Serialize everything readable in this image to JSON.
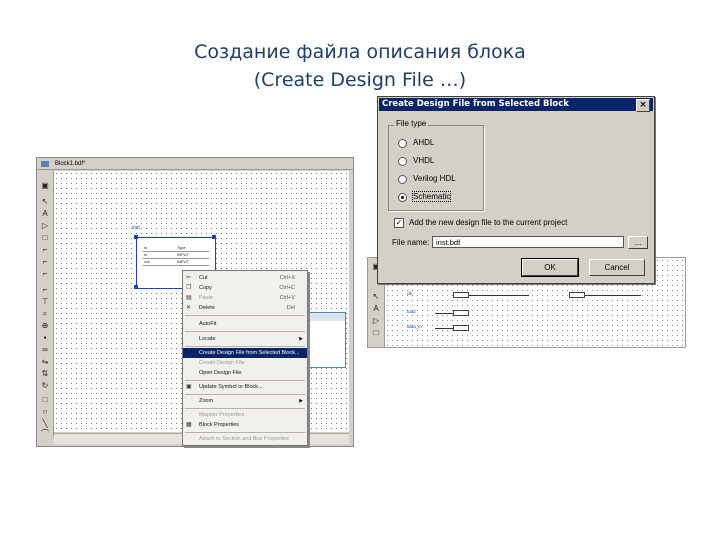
{
  "slide": {
    "title_line1": "Создание файла описания блока",
    "title_line2": "(Create Design File …)"
  },
  "editor": {
    "title": "Block1.bdf*",
    "block_label": "inst",
    "block_table": [
      [
        "in",
        "Type"
      ],
      [
        "in",
        "INPUT"
      ],
      [
        "out",
        "INPUT"
      ]
    ]
  },
  "context_menu": {
    "items": [
      {
        "label": "Cut",
        "shortcut": "Ctrl+X",
        "icon": "scissors-icon"
      },
      {
        "label": "Copy",
        "shortcut": "Ctrl+C",
        "icon": "copy-icon"
      },
      {
        "label": "Paste",
        "shortcut": "Ctrl+V",
        "icon": "paste-icon"
      },
      {
        "label": "Delete",
        "shortcut": "Del",
        "icon": "delete-icon"
      },
      {
        "label": "AutoFit"
      },
      {
        "label": "Locate",
        "submenu": true
      },
      {
        "label": "Create Design File from Selected Block..."
      },
      {
        "label": "Create Design File"
      },
      {
        "label": "Open Design File"
      },
      {
        "label": "Update Symbol or Block...",
        "icon": "update-icon"
      },
      {
        "label": "Zoom",
        "submenu": true
      },
      {
        "label": "Mapper Properties"
      },
      {
        "label": "Block Properties",
        "icon": "properties-icon"
      },
      {
        "label": "Attach to Section and Bus Properties"
      }
    ]
  },
  "editor2": {
    "pins": [
      "clk",
      "load",
      "data_in"
    ]
  },
  "dialog": {
    "title": "Create Design File from Selected Block",
    "close_label": "×",
    "group_label": "File type",
    "radio_options": [
      "AHDL",
      "VHDL",
      "Verilog HDL",
      "Schematic"
    ],
    "selected_option": "Schematic",
    "checkbox_label": "Add the new design file to the current project",
    "checkbox_checked": true,
    "file_name_label": "File name:",
    "file_name_value": "inst.bdf",
    "browse_label": "...",
    "ok_label": "OK",
    "cancel_label": "Cancel"
  },
  "colors": {
    "title_text": "#1f3f6b",
    "dialog_titlebar": "#0a246a",
    "menu_highlight": "#0a246a",
    "block_outline": "#1e3fbf"
  }
}
